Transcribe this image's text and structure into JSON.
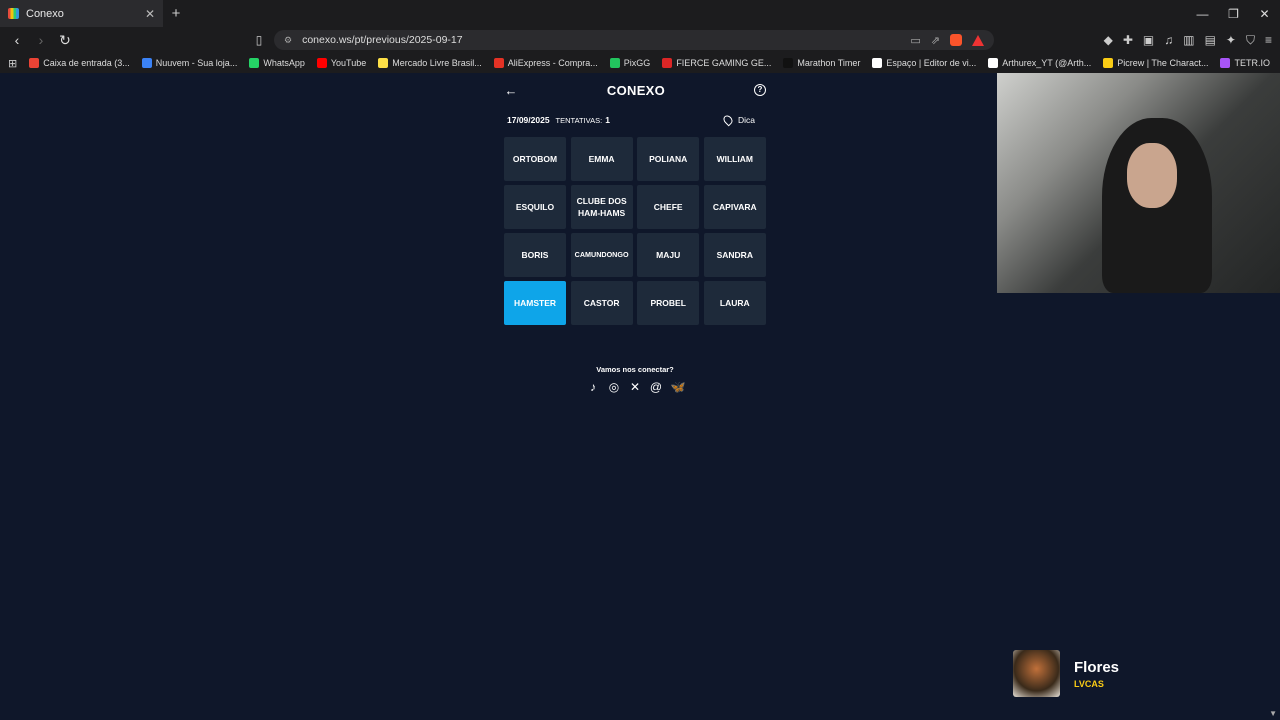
{
  "browser": {
    "tab_title": "Conexo",
    "new_tab": "+",
    "close": "✕",
    "url": "conexo.ws/pt/previous/2025-09-17",
    "bookmarks": [
      {
        "label": "Caixa de entrada (3...",
        "color": "#ea4335"
      },
      {
        "label": "Nuuvem - Sua loja...",
        "color": "#3b82f6"
      },
      {
        "label": "WhatsApp",
        "color": "#25d366"
      },
      {
        "label": "YouTube",
        "color": "#ff0000"
      },
      {
        "label": "Mercado Livre Brasil...",
        "color": "#fde047"
      },
      {
        "label": "AliExpress - Compra...",
        "color": "#e43225"
      },
      {
        "label": "PixGG",
        "color": "#22c55e"
      },
      {
        "label": "FIERCE GAMING GE...",
        "color": "#dc2626"
      },
      {
        "label": "Marathon Timer",
        "color": "#111111"
      },
      {
        "label": "Espaço | Editor de vi...",
        "color": "#ffffff"
      },
      {
        "label": "Arthurex_YT (@Arth...",
        "color": "#ffffff"
      },
      {
        "label": "Picrew | The Charact...",
        "color": "#facc15"
      },
      {
        "label": "TETR.IO",
        "color": "#a855f7"
      }
    ]
  },
  "game": {
    "logo": "CONEXO",
    "date": "17/09/2025",
    "attempts_label": "TENTATIVAS:",
    "attempts_count": "1",
    "hint_label": "Dica",
    "words": [
      "ORTOBOM",
      "EMMA",
      "POLIANA",
      "WILLIAM",
      "ESQUILO",
      "CLUBE DOS\nHAM-HAMS",
      "CHEFE",
      "CAPIVARA",
      "BORIS",
      "CAMUNDONGO",
      "MAJU",
      "SANDRA",
      "HAMSTER",
      "CASTOR",
      "PROBEL",
      "LAURA"
    ],
    "selected_index": 12,
    "accent_color": "#0ea5e9"
  },
  "social": {
    "label": "Vamos nos conectar?",
    "icons": [
      "tiktok-icon",
      "instagram-icon",
      "x-icon",
      "threads-icon",
      "bluesky-icon"
    ]
  },
  "now_playing": {
    "title": "Flores",
    "artist": "LVCAS"
  }
}
